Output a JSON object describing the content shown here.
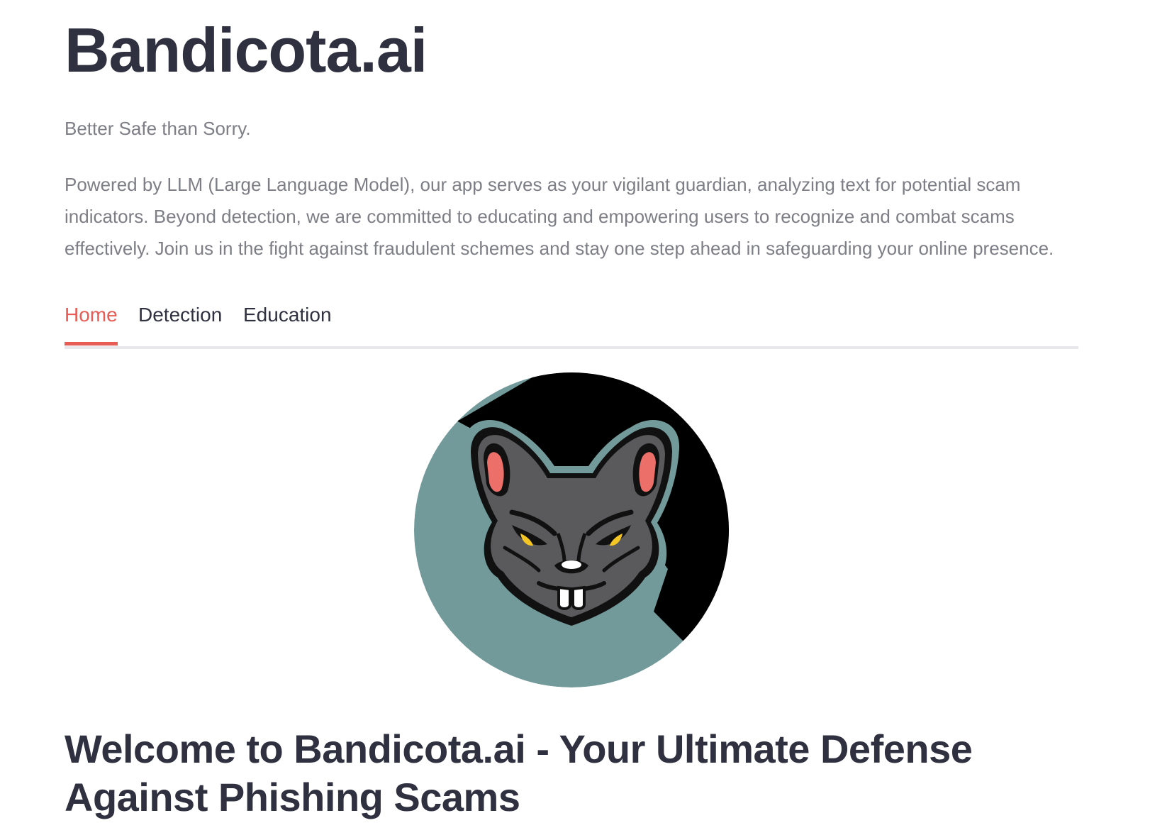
{
  "header": {
    "title": "Bandicota.ai",
    "tagline": "Better Safe than Sorry.",
    "description": "Powered by LLM (Large Language Model), our app serves as your vigilant guardian, analyzing text for potential scam indicators. Beyond detection, we are committed to educating and empowering users to recognize and combat scams effectively. Join us in the fight against fraudulent schemes and stay one step ahead in safeguarding your online presence."
  },
  "tabs": [
    {
      "label": "Home",
      "active": true
    },
    {
      "label": "Detection",
      "active": false
    },
    {
      "label": "Education",
      "active": false
    }
  ],
  "main": {
    "logo_icon": "rat-mascot-logo",
    "heading": "Welcome to Bandicota.ai - Your Ultimate Defense Against Phishing Scams"
  },
  "colors": {
    "accent": "#e85c55",
    "text": "#2f3140",
    "muted": "#7d7e86",
    "logo_teal": "#739a9a",
    "logo_black": "#000000",
    "logo_gray": "#5a5a5c"
  }
}
